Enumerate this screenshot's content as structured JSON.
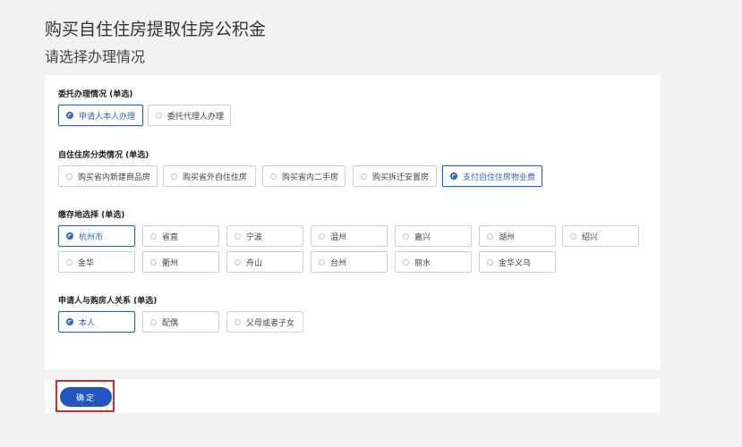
{
  "page": {
    "title": "购买自住住房提取住房公积金",
    "subtitle": "请选择办理情况"
  },
  "groups": {
    "delegation": {
      "label": "委托办理情况 (单选)",
      "options": [
        "申请人本人办理",
        "委托代理人办理"
      ],
      "selected": 0
    },
    "housing_type": {
      "label": "自住住房分类情况 (单选)",
      "options": [
        "购买省内新建商品房",
        "购买省外自住住房",
        "购买省内二手房",
        "购买拆迁安置房",
        "支付自住住房物业费"
      ],
      "selected": 4
    },
    "deposit_location": {
      "label": "缴存地选择 (单选)",
      "options": [
        "杭州市",
        "省直",
        "宁波",
        "温州",
        "嘉兴",
        "湖州",
        "绍兴",
        "金华",
        "衢州",
        "舟山",
        "台州",
        "丽水",
        "金华义乌"
      ],
      "selected": 0
    },
    "relationship": {
      "label": "申请人与购房人关系 (单选)",
      "options": [
        "本人",
        "配偶",
        "父母或者子女"
      ],
      "selected": 0
    }
  },
  "footer": {
    "confirm_label": "确定"
  },
  "colors": {
    "accent": "#2b63c9",
    "button": "#2254c2",
    "highlight": "#d6272b"
  }
}
